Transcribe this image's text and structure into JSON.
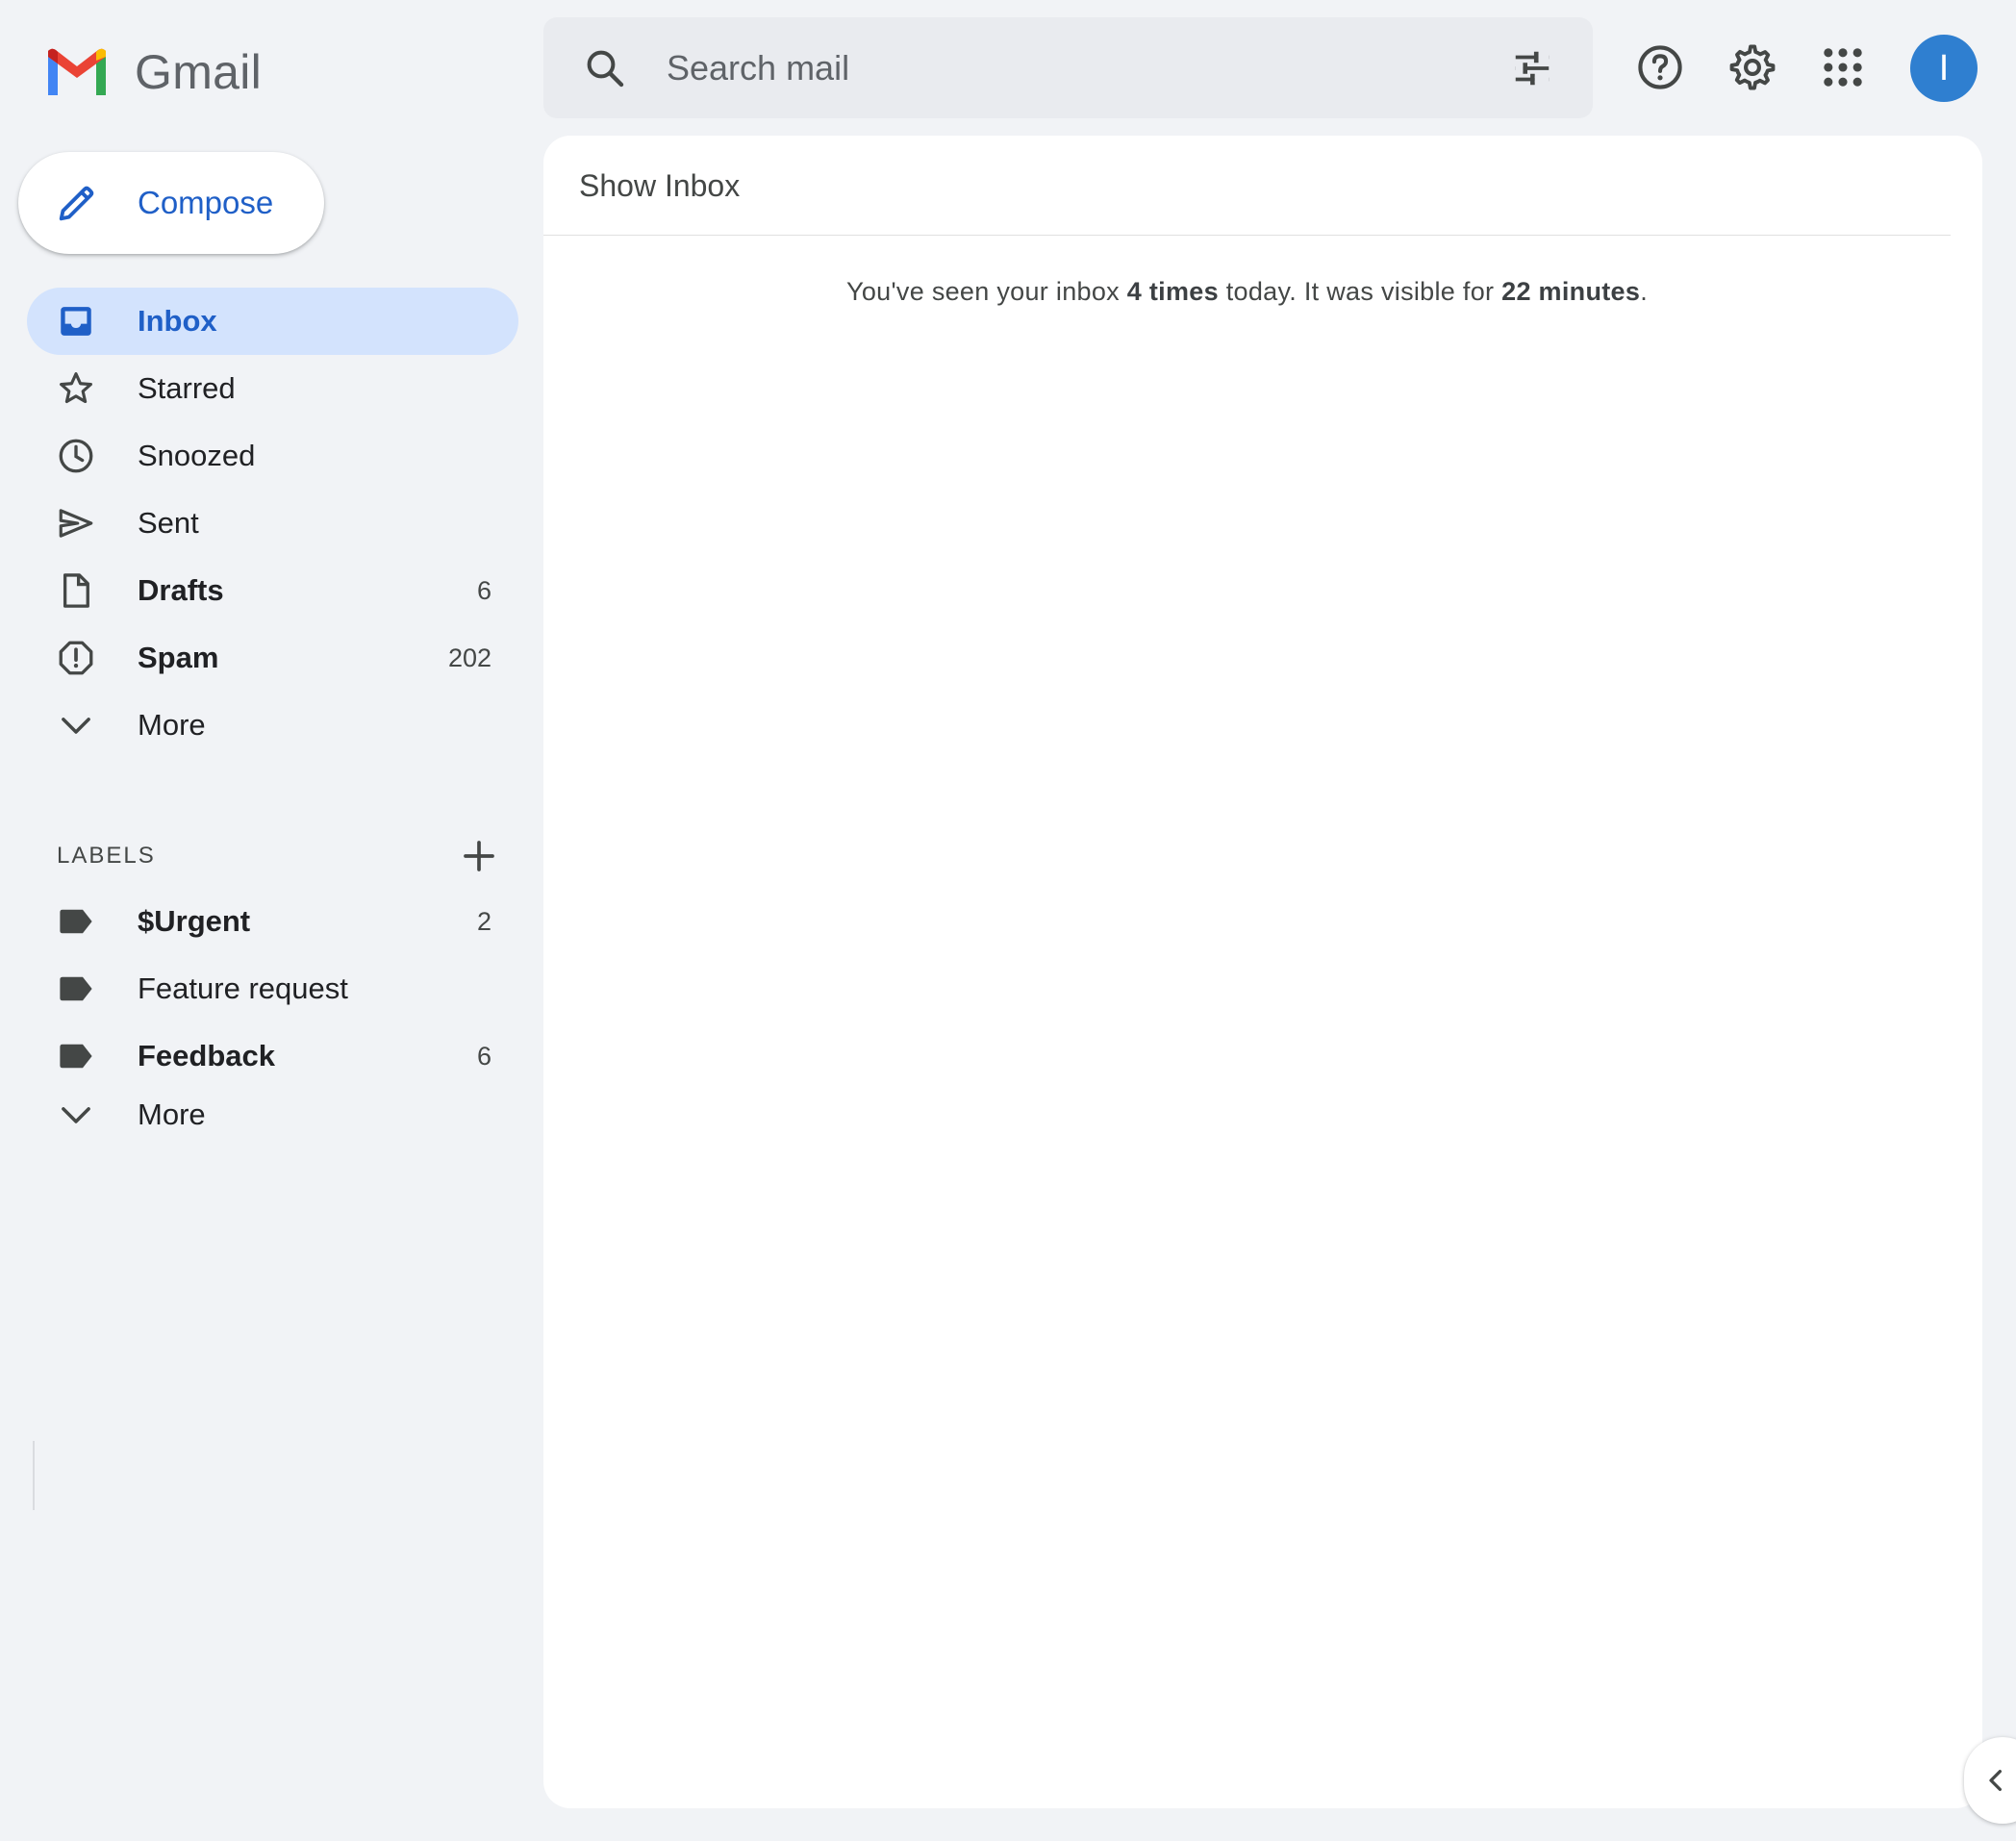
{
  "app": {
    "name": "Gmail"
  },
  "search": {
    "placeholder": "Search mail"
  },
  "header": {
    "support_icon": "help-circle-icon",
    "settings_icon": "gear-icon",
    "apps_icon": "grid-apps-icon",
    "avatar_letter": "I",
    "avatar_color": "#2f7fd0"
  },
  "compose": {
    "label": "Compose"
  },
  "nav": {
    "items": [
      {
        "label": "Inbox",
        "count": "",
        "icon": "inbox-icon",
        "active": true
      },
      {
        "label": "Starred",
        "count": "",
        "icon": "star-icon"
      },
      {
        "label": "Snoozed",
        "count": "",
        "icon": "clock-icon"
      },
      {
        "label": "Sent",
        "count": "",
        "icon": "send-icon"
      },
      {
        "label": "Drafts",
        "count": "6",
        "icon": "draft-file-icon"
      },
      {
        "label": "Spam",
        "count": "202",
        "icon": "spam-icon"
      },
      {
        "label": "More",
        "count": "",
        "icon": "chevron-down-icon"
      }
    ]
  },
  "labels": {
    "title": "LABELS",
    "items": [
      {
        "label": "$Urgent",
        "count": "2",
        "icon": "label-tag-icon"
      },
      {
        "label": "Feature request",
        "count": "",
        "icon": "label-tag-icon"
      },
      {
        "label": "Feedback",
        "count": "6",
        "icon": "label-tag-icon"
      },
      {
        "label": "More",
        "count": "",
        "icon": "chevron-down-icon"
      }
    ]
  },
  "main": {
    "title": "Show Inbox",
    "stats": {
      "prefix": "You've seen your inbox ",
      "times": "4 times",
      "middle": " today. It was visible for ",
      "duration": "22 minutes",
      "suffix": "."
    }
  },
  "colors": {
    "accent": "#1f5fc7",
    "active_bg": "#d3e3fd",
    "page_bg": "#f1f3f6"
  }
}
